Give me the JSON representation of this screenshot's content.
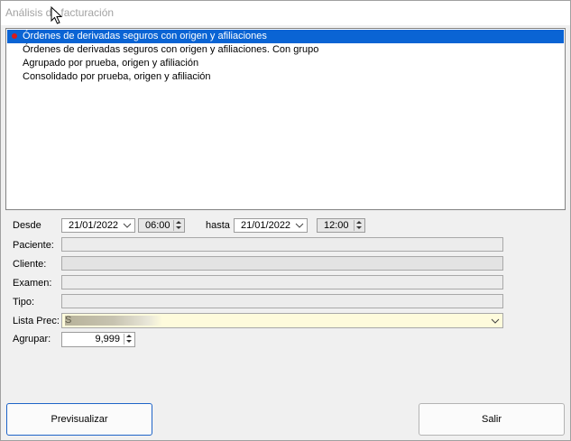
{
  "window": {
    "title": "Análisis de facturación"
  },
  "list": {
    "items": [
      {
        "label": "Órdenes de derivadas seguros con origen y afiliaciones",
        "selected": true
      },
      {
        "label": "Órdenes de derivadas seguros con origen y afiliaciones. Con grupo",
        "selected": false
      },
      {
        "label": "Agrupado por prueba, origen y afiliación",
        "selected": false
      },
      {
        "label": "Consolidado por prueba, origen y afiliación",
        "selected": false
      }
    ]
  },
  "filters": {
    "desde_label": "Desde",
    "desde_date": "21/01/2022",
    "desde_time": "06:00",
    "hasta_label": "hasta",
    "hasta_date": "21/01/2022",
    "hasta_time": "12:00",
    "paciente_label": "Paciente:",
    "cliente_label": "Cliente:",
    "examen_label": "Examen:",
    "tipo_label": "Tipo:",
    "lista_prec_label": "Lista Prec:",
    "lista_prec_value": "S",
    "agrupar_label": "Agrupar:",
    "agrupar_value": "9,999"
  },
  "buttons": {
    "preview": "Previsualizar",
    "exit": "Salir"
  },
  "colors": {
    "selection": "#0a64d4",
    "marker": "#d91b1b",
    "combo_bg": "#fefbdc",
    "primary_border": "#1e64c8"
  }
}
